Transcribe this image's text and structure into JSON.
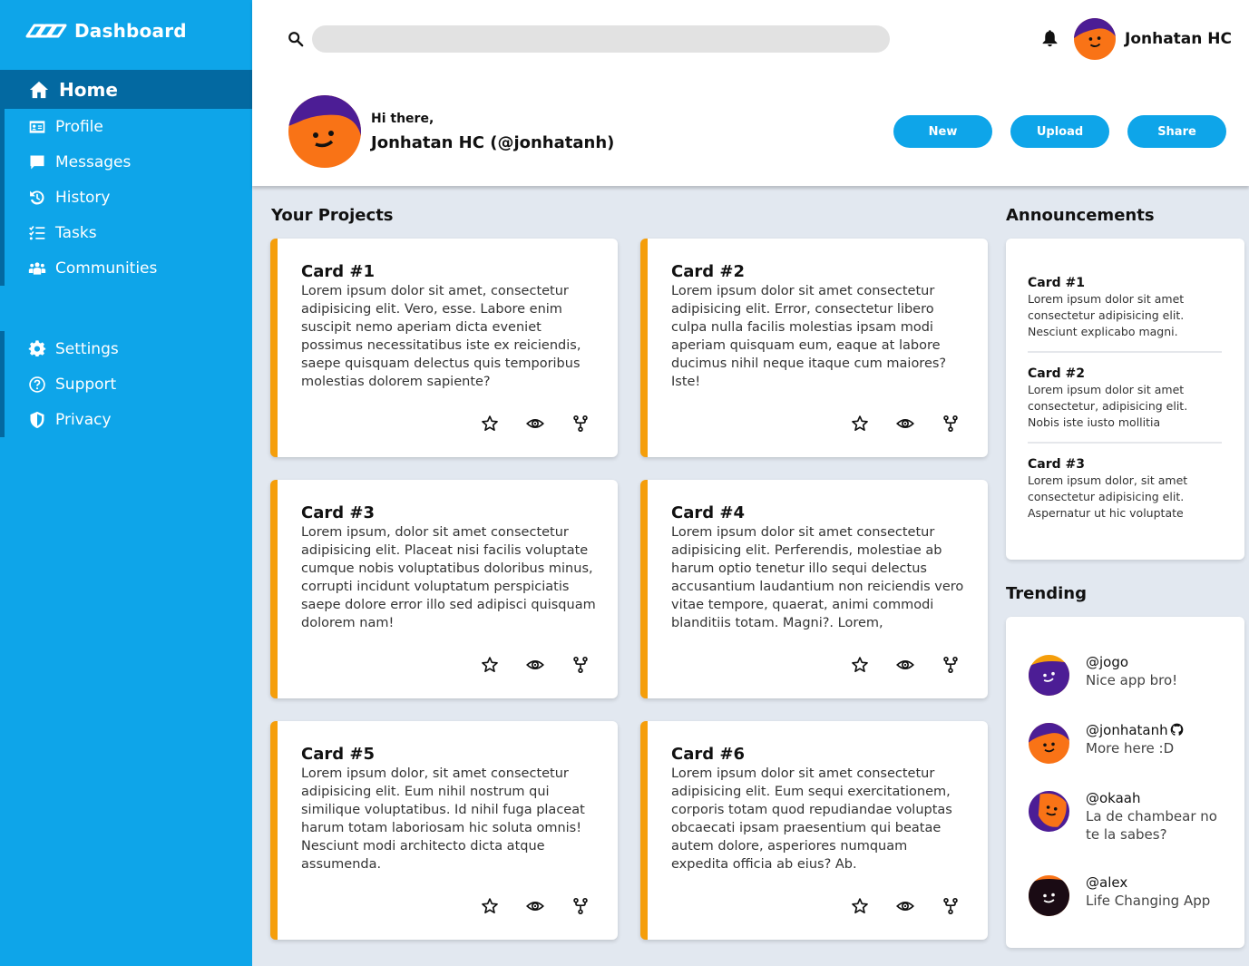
{
  "sidebar": {
    "brand": "Dashboard",
    "items": [
      {
        "label": "Home",
        "icon": "home-icon",
        "active": true
      },
      {
        "label": "Profile",
        "icon": "id-card-icon"
      },
      {
        "label": "Messages",
        "icon": "message-icon"
      },
      {
        "label": "History",
        "icon": "history-icon"
      },
      {
        "label": "Tasks",
        "icon": "tasks-icon"
      },
      {
        "label": "Communities",
        "icon": "users-icon"
      }
    ],
    "secondary": [
      {
        "label": "Settings",
        "icon": "gear-icon"
      },
      {
        "label": "Support",
        "icon": "question-icon"
      },
      {
        "label": "Privacy",
        "icon": "shield-icon"
      }
    ]
  },
  "header": {
    "search_placeholder": "",
    "user_name": "Jonhatan HC",
    "greeting": "Hi there,",
    "full_name": "Jonhatan HC (@jonhatanh)",
    "buttons": {
      "new": "New",
      "upload": "Upload",
      "share": "Share"
    }
  },
  "projects": {
    "title": "Your Projects",
    "cards": [
      {
        "title": "Card #1",
        "text": "Lorem ipsum dolor sit amet, consectetur adipisicing elit. Vero, esse. Labore enim suscipit nemo aperiam dicta eveniet possimus necessitatibus iste ex reiciendis, saepe quisquam delectus quis temporibus molestias dolorem sapiente?"
      },
      {
        "title": "Card #2",
        "text": "Lorem ipsum dolor sit amet consectetur adipisicing elit. Error, consectetur libero culpa nulla facilis molestias ipsam modi aperiam quisquam eum, eaque at labore ducimus nihil neque itaque cum maiores? Iste!"
      },
      {
        "title": "Card #3",
        "text": "Lorem ipsum, dolor sit amet consectetur adipisicing elit. Placeat nisi facilis voluptate cumque nobis voluptatibus doloribus minus, corrupti incidunt voluptatum perspiciatis saepe dolore error illo sed adipisci quisquam dolorem nam!"
      },
      {
        "title": "Card #4",
        "text": "Lorem ipsum dolor sit amet consectetur adipisicing elit. Perferendis, molestiae ab harum optio tenetur illo sequi delectus accusantium laudantium non reiciendis vero vitae tempore, quaerat, animi commodi blanditiis totam. Magni?. Lorem,"
      },
      {
        "title": "Card #5",
        "text": "Lorem ipsum dolor, sit amet consectetur adipisicing elit. Eum nihil nostrum qui similique voluptatibus. Id nihil fuga placeat harum totam laboriosam hic soluta omnis! Nesciunt modi architecto dicta atque assumenda."
      },
      {
        "title": "Card #6",
        "text": "Lorem ipsum dolor sit amet consectetur adipisicing elit. Eum sequi exercitationem, corporis totam quod repudiandae voluptas obcaecati ipsam praesentium qui beatae autem dolore, asperiores numquam expedita officia ab eius? Ab."
      }
    ],
    "card_actions": [
      "star-icon",
      "eye-icon",
      "fork-icon"
    ]
  },
  "announcements": {
    "title": "Announcements",
    "items": [
      {
        "title": "Card #1",
        "text": "Lorem ipsum dolor sit amet consectetur adipisicing elit. Nesciunt explicabo magni."
      },
      {
        "title": "Card #2",
        "text": "Lorem ipsum dolor sit amet consectetur, adipisicing elit. Nobis iste iusto mollitia"
      },
      {
        "title": "Card #3",
        "text": "Lorem ipsum dolor, sit amet consectetur adipisicing elit. Aspernatur ut hic voluptate"
      }
    ]
  },
  "trending": {
    "title": "Trending",
    "items": [
      {
        "handle": "@jogo",
        "text": "Nice app bro!"
      },
      {
        "handle": "@jonhatanh",
        "text": "More here :D",
        "icon": "github-icon"
      },
      {
        "handle": "@okaah",
        "text": "La de chambear no te la sabes?"
      },
      {
        "handle": "@alex",
        "text": "Life Changing App"
      }
    ]
  },
  "colors": {
    "sidebar": "#0ea5e9",
    "sidebar_active": "#0369a1",
    "card_accent": "#f59e0b",
    "avatar_orange": "#f97316",
    "avatar_purple": "#4c1d95",
    "background": "#e2e8f0"
  }
}
